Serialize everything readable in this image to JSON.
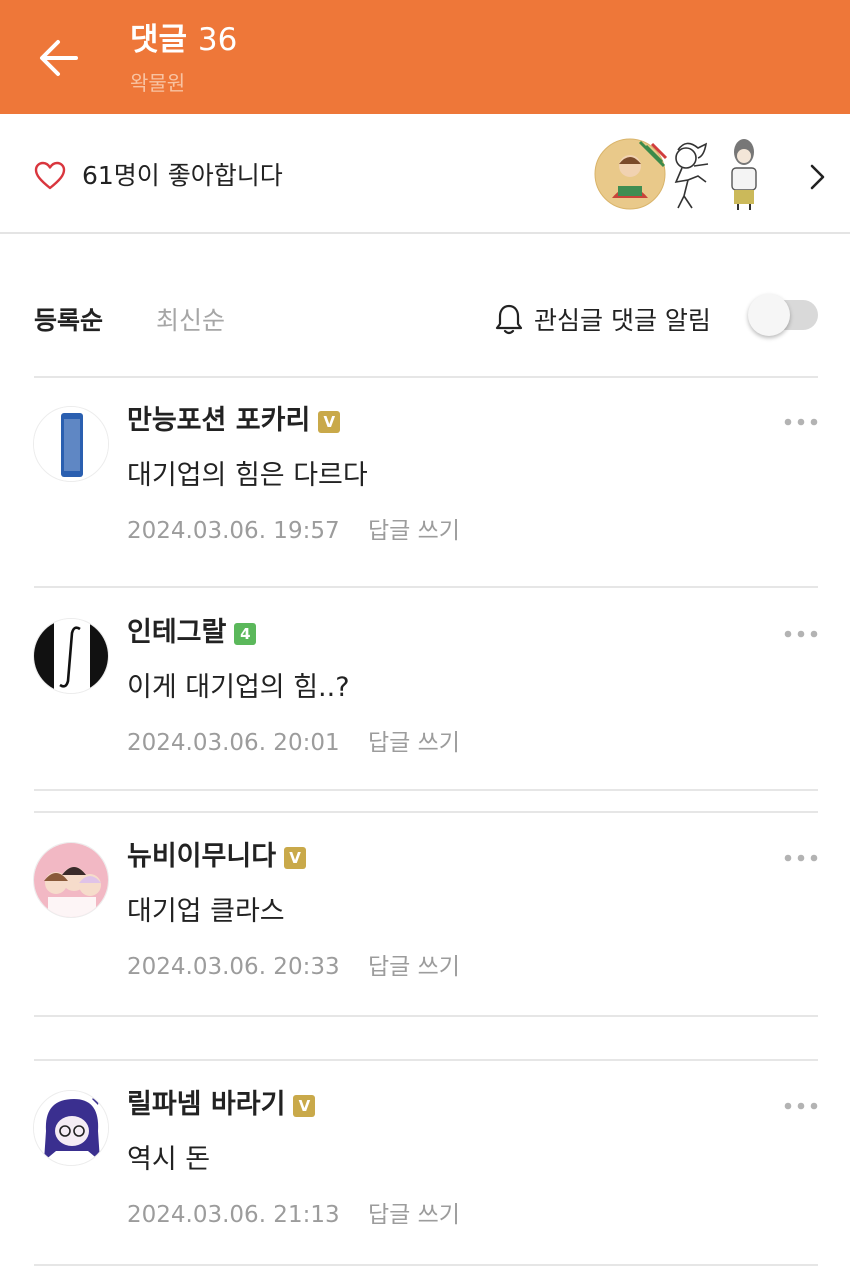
{
  "header": {
    "title": "댓글",
    "comment_count": "36",
    "subtitle": "왁물원"
  },
  "likes": {
    "text": "61명이 좋아합니다"
  },
  "sort": {
    "active_tab": "등록순",
    "inactive_tab": "최신순",
    "notify_label": "관심글 댓글 알림",
    "notify_enabled": false
  },
  "comments": [
    {
      "nickname": "만능포션 포카리",
      "badge": "V",
      "text": "대기업의 힘은 다르다",
      "date": "2024.03.06. 19:57",
      "reply_label": "답글 쓰기"
    },
    {
      "nickname": "인테그랄",
      "badge": "4",
      "text": "이게 대기업의 힘..?",
      "date": "2024.03.06. 20:01",
      "reply_label": "답글 쓰기"
    },
    {
      "nickname": "뉴비이무니다",
      "badge": "V",
      "text": "대기업 클라스",
      "date": "2024.03.06. 20:33",
      "reply_label": "답글 쓰기"
    },
    {
      "nickname": "릴파넴 바라기",
      "badge": "V",
      "text": "역시 돈",
      "date": "2024.03.06. 21:13",
      "reply_label": "답글 쓰기"
    }
  ],
  "colors": {
    "header_bg": "#ee7739",
    "badge_v": "#c9a94a",
    "badge_level": "#5bb85b",
    "heart": "#d9363e"
  },
  "icons": [
    "back-arrow-icon",
    "heart-icon",
    "chevron-right-icon",
    "bell-icon",
    "more-dots-icon"
  ]
}
